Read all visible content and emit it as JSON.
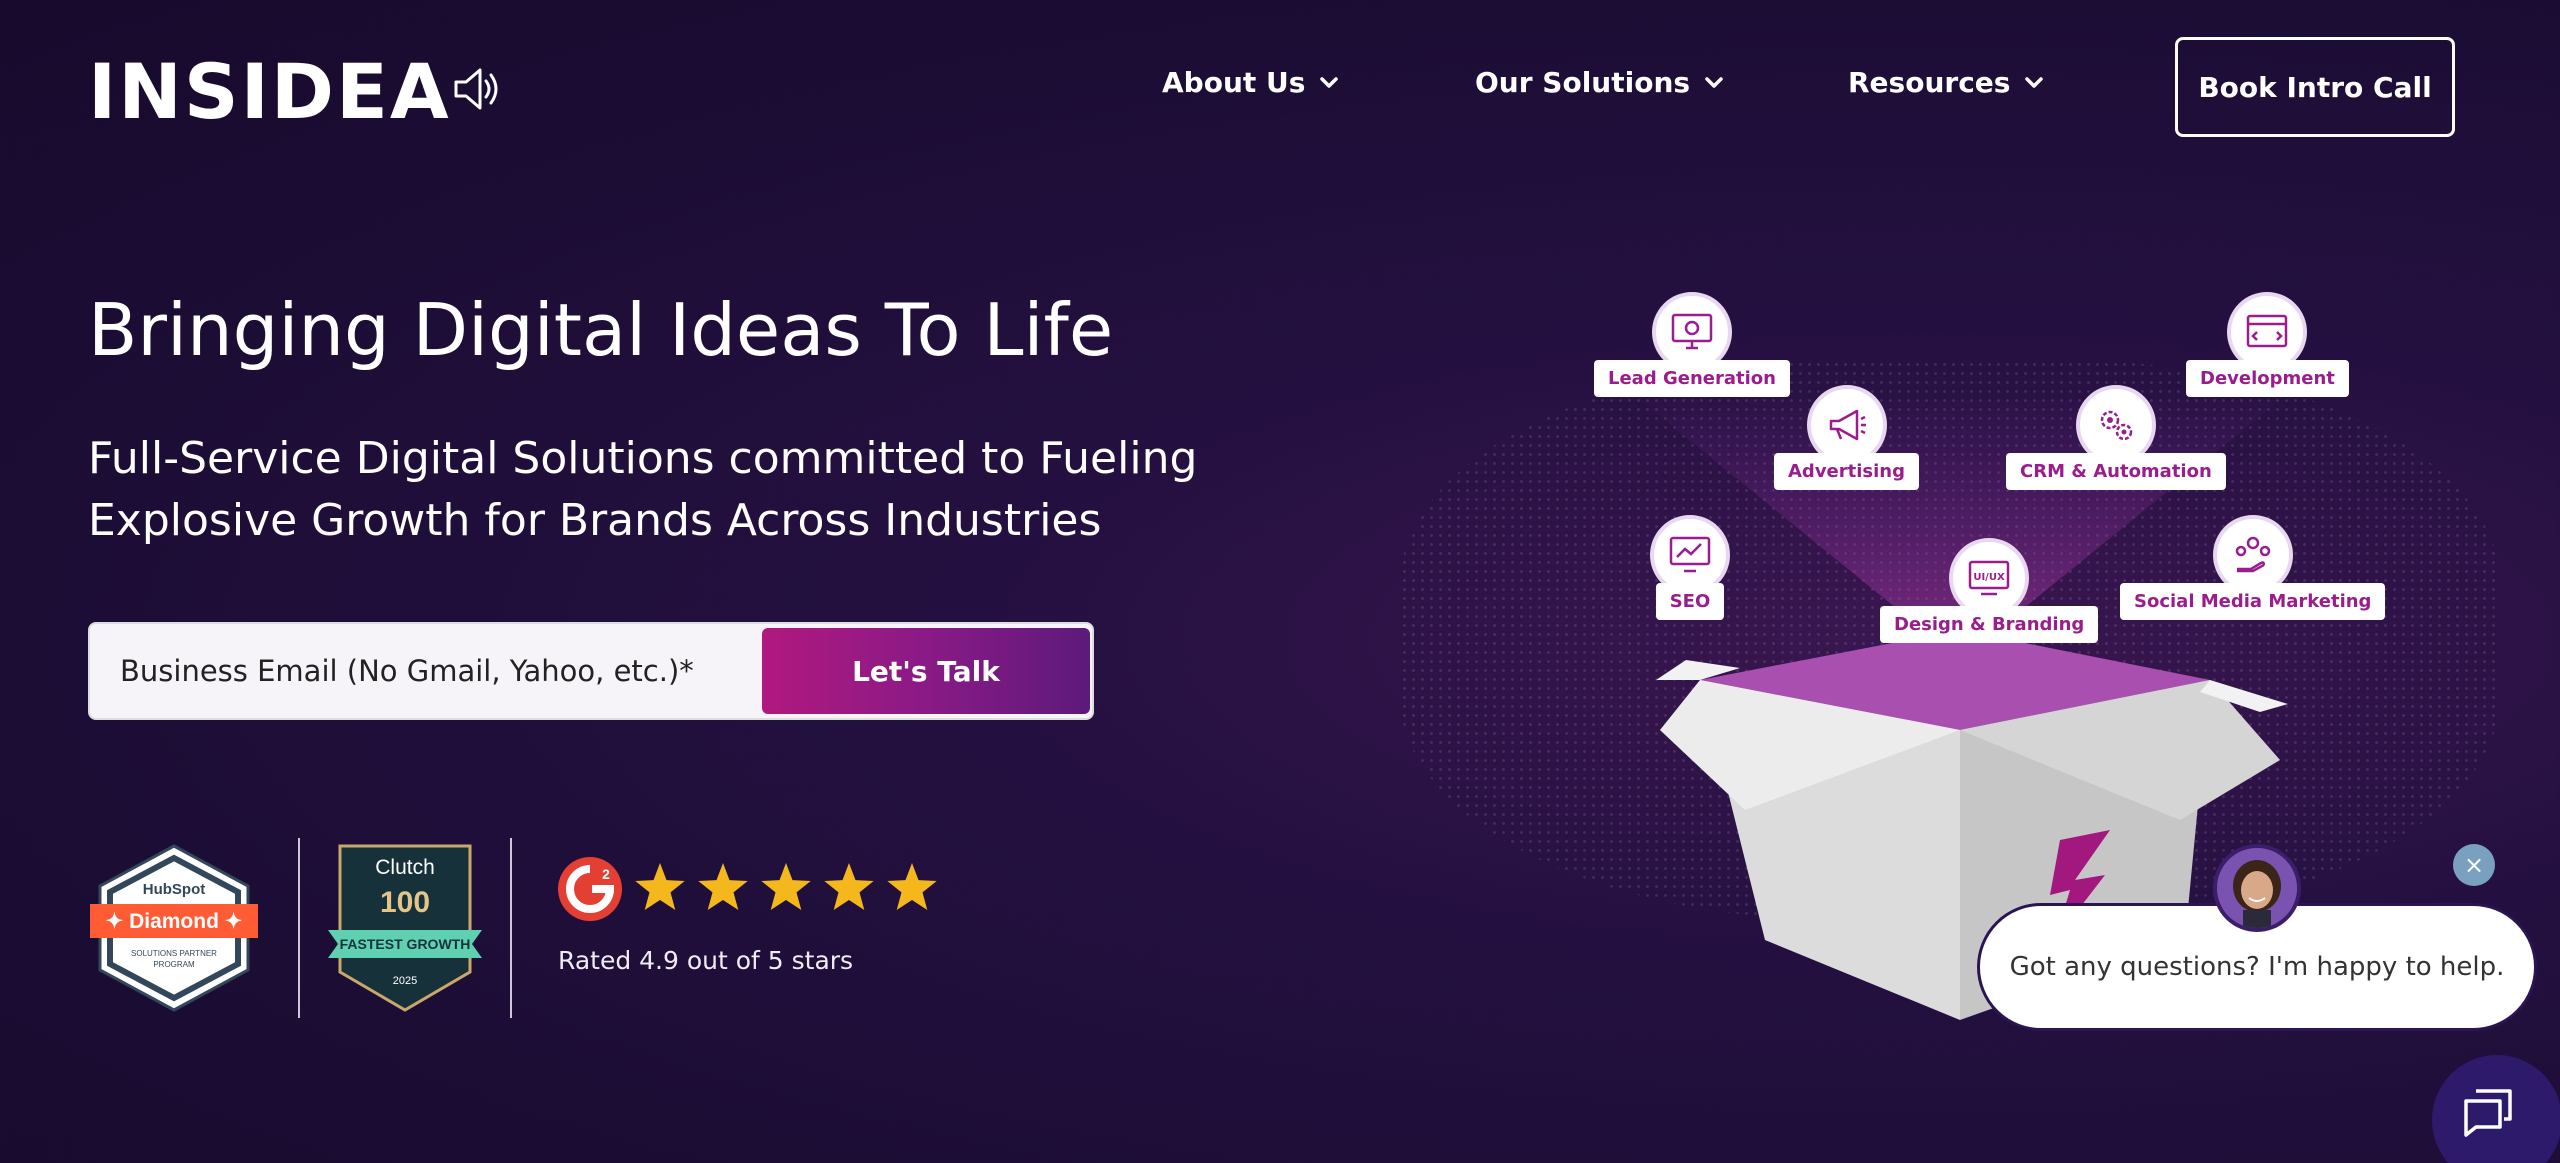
{
  "header": {
    "logo": "INSIDEA",
    "nav": [
      {
        "label": "About Us"
      },
      {
        "label": "Our Solutions"
      },
      {
        "label": "Resources"
      }
    ],
    "cta_label": "Book Intro Call"
  },
  "hero": {
    "title": "Bringing Digital Ideas To Life",
    "subtitle": "Full-Service Digital Solutions committed to Fueling Explosive Growth for Brands Across Industries",
    "email_placeholder": "Business Email (No Gmail, Yahoo, etc.)*",
    "submit_label": "Let's Talk"
  },
  "badges": {
    "hubspot": {
      "brand": "HubSpot",
      "tier": "Diamond",
      "caption": "SOLUTIONS PARTNER PROGRAM"
    },
    "clutch": {
      "brand": "Clutch",
      "rank": "100",
      "ribbon": "FASTEST GROWTH",
      "year": "2025"
    },
    "g2": {
      "rating_text": "Rated 4.9 out of 5 stars",
      "stars": 5
    }
  },
  "services": [
    {
      "label": "Lead Generation",
      "icon": "monitor-gear-icon"
    },
    {
      "label": "Development",
      "icon": "browser-code-icon"
    },
    {
      "label": "Advertising",
      "icon": "megaphone-icon"
    },
    {
      "label": "CRM & Automation",
      "icon": "gears-icon"
    },
    {
      "label": "SEO",
      "icon": "monitor-chart-icon"
    },
    {
      "label": "Design & Branding",
      "icon": "ui-ux-icon"
    },
    {
      "label": "Social Media Marketing",
      "icon": "social-hand-icon"
    }
  ],
  "chat": {
    "message": "Got any questions? I'm happy to help.",
    "close": "×"
  },
  "colors": {
    "background": "#1c0d35",
    "accent_magenta": "#b0197f",
    "accent_purple": "#5c1a7a",
    "service_text": "#9a1d8e"
  }
}
